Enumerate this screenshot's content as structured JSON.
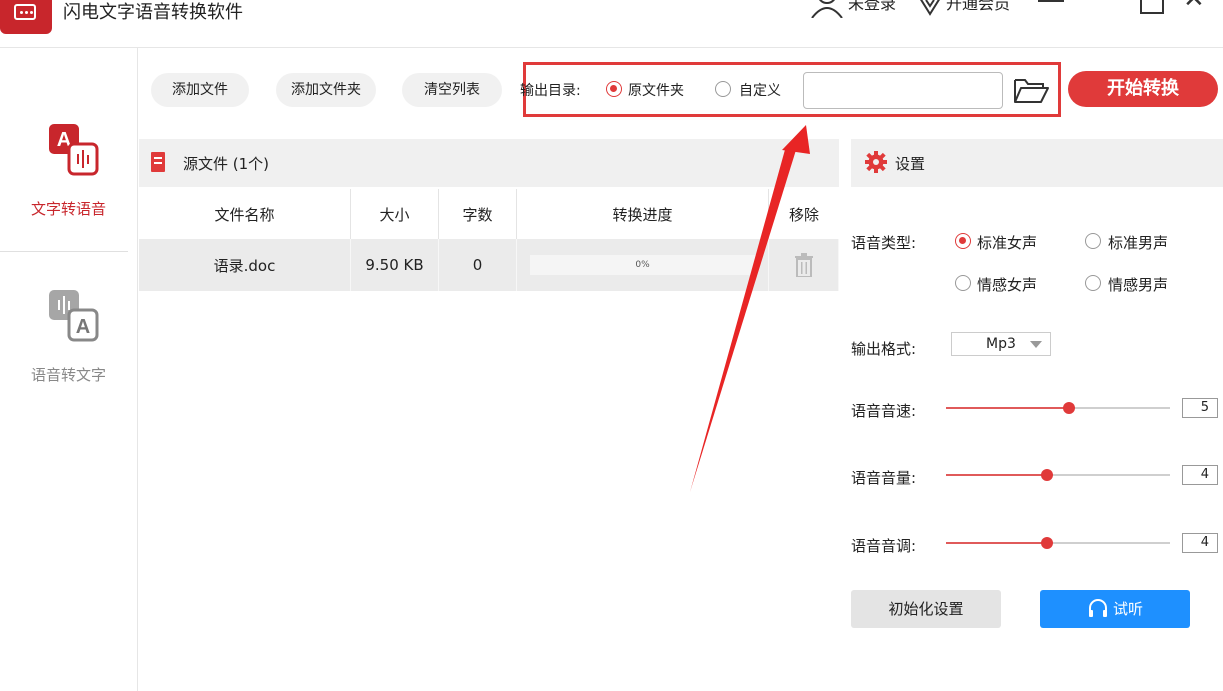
{
  "app": {
    "title": "闪电文字语音转换软件"
  },
  "titlebar": {
    "login": "未登录",
    "vip": "开通会员"
  },
  "sidebar": {
    "items": [
      {
        "label": "文字转语音",
        "active": true
      },
      {
        "label": "语音转文字",
        "active": false
      }
    ]
  },
  "toolbar": {
    "add_file": "添加文件",
    "add_folder": "添加文件夹",
    "clear_list": "清空列表",
    "output_label": "输出目录:",
    "opt_source_folder": "原文件夹",
    "opt_custom": "自定义",
    "path_value": "",
    "start": "开始转换"
  },
  "source": {
    "title": "源文件 (1个)",
    "columns": [
      "文件名称",
      "大小",
      "字数",
      "转换进度",
      "移除"
    ],
    "rows": [
      {
        "name": "语录.doc",
        "size": "9.50 KB",
        "words": "0",
        "progress": "0%"
      }
    ]
  },
  "settings": {
    "title": "设置",
    "voice_type_label": "语音类型:",
    "voices": [
      "标准女声",
      "标准男声",
      "情感女声",
      "情感男声"
    ],
    "selected_voice": "标准女声",
    "format_label": "输出格式:",
    "format_value": "Mp3",
    "speed_label": "语音音速:",
    "speed_value": "5",
    "volume_label": "语音音量:",
    "volume_value": "4",
    "pitch_label": "语音音调:",
    "pitch_value": "4",
    "slider_levels": {
      "speed": 0.55,
      "volume": 0.45,
      "pitch": 0.45
    },
    "reset": "初始化设置",
    "listen": "试听"
  },
  "colors": {
    "accent": "#e03a3a",
    "brand": "#c8262c",
    "listen": "#1e90ff"
  },
  "icons": [
    "app-logo-icon",
    "user-icon",
    "vip-diamond-icon",
    "menu-icon",
    "maximize-icon",
    "close-icon",
    "text-to-speech-icon",
    "speech-to-text-icon",
    "folder-open-icon",
    "document-icon",
    "trash-icon",
    "gear-icon",
    "headphones-icon"
  ]
}
